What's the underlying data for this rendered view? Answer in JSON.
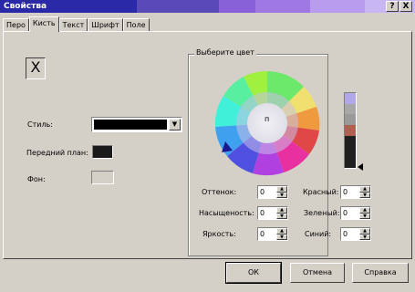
{
  "window": {
    "title": "Свойства",
    "help_glyph": "?",
    "close_glyph": "X",
    "titlebar_colors": [
      "#2020a8",
      "#4040b8",
      "#7b4fc8",
      "#9a66e0",
      "#b092ee",
      "#c4b0f2"
    ]
  },
  "tabs": [
    {
      "label": "Перо",
      "active": false
    },
    {
      "label": "Кисть",
      "active": true
    },
    {
      "label": "Текст",
      "active": false
    },
    {
      "label": "Шрифт",
      "active": false
    },
    {
      "label": "Поле",
      "active": false
    }
  ],
  "brush": {
    "no_fill_glyph": "X",
    "style_label": "Стиль:",
    "style_value_color": "#000000",
    "foreground_label": "Передний план:",
    "foreground_color": "#1a1a1a",
    "background_label": "Фон:",
    "background_color": "#d4d0c8"
  },
  "color_picker": {
    "title": "Выберите цвет",
    "center_marker": "п",
    "gradient": [
      "#b0a8e8",
      "#a8a8a8",
      "#9a9a9a",
      "#b06050",
      "#202020",
      "#202020",
      "#202020"
    ],
    "fields": [
      {
        "label": "Оттенок:",
        "value": "0"
      },
      {
        "label": "Насыщеность:",
        "value": "0"
      },
      {
        "label": "Яркость:",
        "value": "0"
      },
      {
        "label": "Красный:",
        "value": "0"
      },
      {
        "label": "Зеленый:",
        "value": "0"
      },
      {
        "label": "Синий:",
        "value": "0"
      }
    ]
  },
  "buttons": {
    "ok": "ОК",
    "cancel": "Отмена",
    "help": "Справка"
  }
}
